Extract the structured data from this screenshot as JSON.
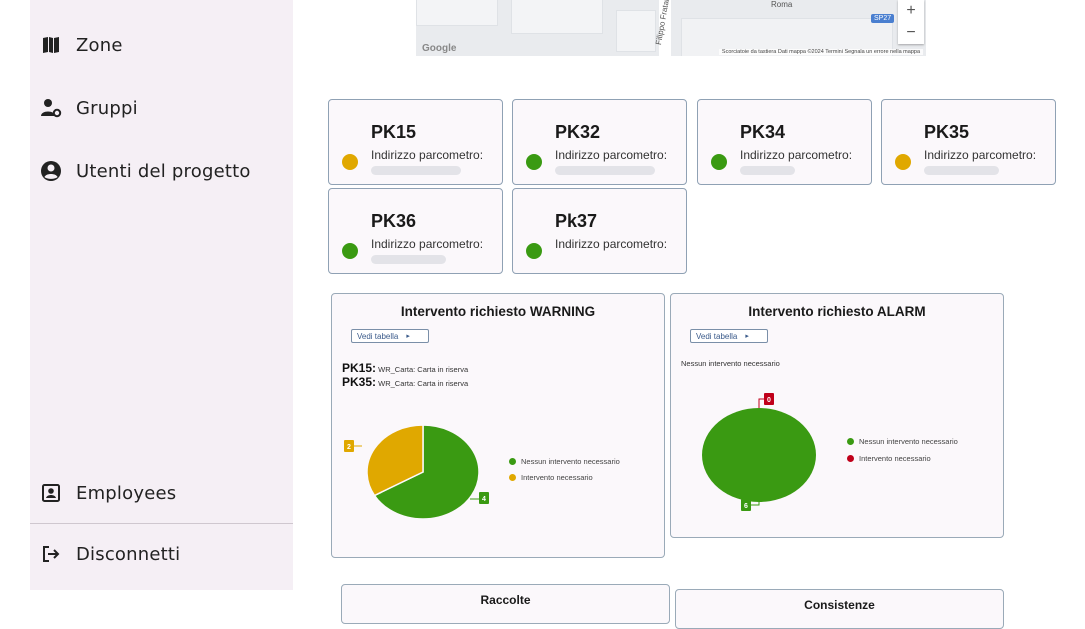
{
  "sidebar": {
    "items": [
      {
        "label": "Zone",
        "icon": "map-icon"
      },
      {
        "label": "Gruppi",
        "icon": "group-settings-icon"
      },
      {
        "label": "Utenti del progetto",
        "icon": "account-circle-icon"
      },
      {
        "label": "Employees",
        "icon": "badge-icon"
      },
      {
        "label": "Disconnetti",
        "icon": "logout-icon"
      }
    ]
  },
  "map": {
    "street_1": "Filippo Fratal",
    "street_2": "Roma",
    "road_badge": "SP27",
    "zoom_in": "+",
    "zoom_out": "−",
    "google": "Google",
    "attribution": "Scorciatoie da tastiera   Dati mappa ©2024   Termini   Segnala un errore nella mappa"
  },
  "colors": {
    "ok": "#3a9a12",
    "warning": "#e0a800",
    "alarm": "#c0001a"
  },
  "parking_meters": [
    {
      "name": "PK15",
      "status": "warning",
      "address_label": "Indirizzo parcometro:"
    },
    {
      "name": "PK32",
      "status": "ok",
      "address_label": "Indirizzo parcometro:"
    },
    {
      "name": "PK34",
      "status": "ok",
      "address_label": "Indirizzo parcometro:"
    },
    {
      "name": "PK35",
      "status": "warning",
      "address_label": "Indirizzo parcometro:"
    },
    {
      "name": "PK36",
      "status": "ok",
      "address_label": "Indirizzo parcometro:"
    },
    {
      "name": "Pk37",
      "status": "ok",
      "address_label": "Indirizzo parcometro:"
    }
  ],
  "warning_panel": {
    "title": "Intervento richiesto WARNING",
    "button": "Vedi tabella",
    "lines": [
      {
        "pk": "PK15:",
        "text": "WR_Carta: Carta in riserva"
      },
      {
        "pk": "PK35:",
        "text": "WR_Carta: Carta in riserva"
      }
    ],
    "legend": [
      "Nessun intervento necessario",
      "Intervento necessario"
    ]
  },
  "alarm_panel": {
    "title": "Intervento richiesto ALARM",
    "button": "Vedi tabella",
    "message": "Nessun intervento necessario",
    "legend": [
      "Nessun intervento necessario",
      "Intervento necessario"
    ]
  },
  "chart_data": [
    {
      "type": "pie",
      "title": "Intervento richiesto WARNING",
      "categories": [
        "Nessun intervento necessario",
        "Intervento necessario"
      ],
      "values": [
        4,
        2
      ],
      "colors": [
        "#3a9a12",
        "#e0a800"
      ]
    },
    {
      "type": "pie",
      "title": "Intervento richiesto ALARM",
      "categories": [
        "Nessun intervento necessario",
        "Intervento necessario"
      ],
      "values": [
        6,
        0
      ],
      "colors": [
        "#3a9a12",
        "#c0001a"
      ]
    }
  ],
  "bottom": {
    "raccolte": "Raccolte",
    "consistenze": "Consistenze"
  }
}
